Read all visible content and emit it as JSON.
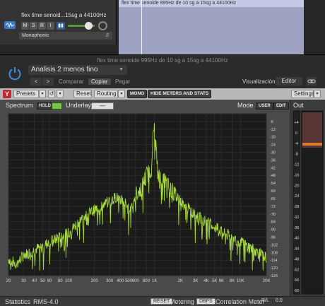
{
  "track": {
    "name": "flex time senoid...15sg a 44100Hz",
    "buttons": [
      "M",
      "S",
      "R",
      "I"
    ],
    "monitor_label": "▮▮",
    "mode": "Monophonic"
  },
  "region": {
    "title": "flex time senoide 995Hz de 10 sg a 15sg a 44100Hz"
  },
  "plugin": {
    "window_title": "flex time senoide 995Hz de 10 sg a 15sg a 44100Hz",
    "preset": "Analisis 2 menos fino",
    "nav_prev": "<",
    "nav_next": ">",
    "compare": "Comparar",
    "copy": "Copiar",
    "paste": "Pegar",
    "view_label": "Visualización:",
    "view_value": "Editor"
  },
  "toolbar": {
    "logo": "Y",
    "presets": "Presets",
    "undo": "↺",
    "reset": "Reset",
    "routing": "Routing",
    "mono": "MONO",
    "hide_meters": "HIDE METERS AND STATS",
    "settings": "Settings",
    "arrow": "▾"
  },
  "spectrum": {
    "label": "Spectrum",
    "hold": "HOLD",
    "underlay": "Underlay",
    "underlay_value": "—",
    "mode_label": "Mode",
    "mode_user": "USER",
    "mode_edit": "EDIT",
    "freq_ticks": [
      "20",
      "30",
      "40",
      "50",
      "60",
      "80",
      "100",
      "200",
      "300",
      "400",
      "500",
      "600",
      "800",
      "1K",
      "2K",
      "3K",
      "4K",
      "5K",
      "6K",
      "8K",
      "10K",
      "20K"
    ],
    "db_ticks": [
      "0",
      "-6",
      "-12",
      "-18",
      "-24",
      "-30",
      "-36",
      "-42",
      "-48",
      "-54",
      "-60",
      "-66",
      "-72",
      "-78",
      "-84",
      "-90",
      "-96",
      "-102",
      "-108",
      "-114",
      "-120",
      "-126"
    ],
    "db_ticks_visible": [
      "-6",
      "-12",
      "-18",
      "-24",
      "-30",
      "-36",
      "-42",
      "-48",
      "-54",
      "-60",
      "-66",
      "-72",
      "-78",
      "-84",
      "-90",
      "-96",
      "-102",
      "-108",
      "-114",
      "-120",
      "-126"
    ],
    "trace_color": "#a6d93a",
    "background": "#1b1b1b",
    "peak_freq_hz": 995
  },
  "output": {
    "label": "Out",
    "scale": [
      "+4",
      "0",
      "-4",
      "-8",
      "-12",
      "-16",
      "-20",
      "-24",
      "-28",
      "-32",
      "-36",
      "-40",
      "-44",
      "-48",
      "-52",
      "-56",
      "-60"
    ],
    "level_color": "#e07a2a"
  },
  "stats": {
    "label": "Statistics",
    "rms_label": "RMS",
    "rms_value": "-4.0",
    "reset": "RESET",
    "metering_label": "Metering",
    "dbfs": "DBFS",
    "correlation_label": "Correlation Meter",
    "rl": "R/L",
    "correlation_value": "0.0"
  },
  "chart_data": {
    "type": "line",
    "title": "",
    "xlabel": "",
    "ylabel": "",
    "x_scale": "log",
    "xlim": [
      20,
      20000
    ],
    "ylim": [
      -126,
      0
    ],
    "grid": true,
    "series": [
      {
        "x": [
          20,
          25,
          30,
          40,
          50,
          60,
          80,
          100,
          130,
          160,
          200,
          250,
          300,
          350,
          400,
          450,
          500,
          550,
          600,
          700,
          800,
          900,
          995,
          1100,
          1300,
          1600,
          2000,
          2500,
          3000,
          4000,
          5000,
          6000,
          8000,
          10000,
          13000,
          16000,
          20000
        ],
        "y": [
          -113,
          -117,
          -110,
          -106,
          -103,
          -100,
          -96,
          -93,
          -84,
          -79,
          -75,
          -71,
          -68,
          -65,
          -66,
          -69,
          -75,
          -70,
          -63,
          -58,
          -48,
          -44,
          -8,
          -48,
          -52,
          -60,
          -68,
          -74,
          -79,
          -84,
          -88,
          -92,
          -96,
          -100,
          -104,
          -108,
          -112
        ]
      }
    ]
  }
}
